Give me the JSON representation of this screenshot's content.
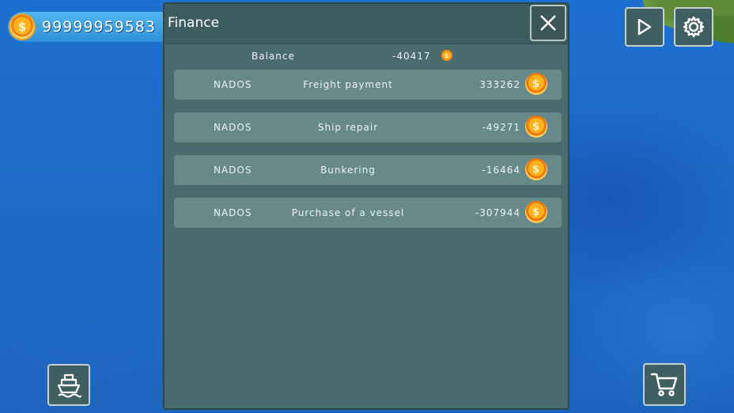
{
  "hud": {
    "coins": "99999959583",
    "coin_symbol": "$"
  },
  "dialog": {
    "title": "Finance",
    "balance_label": "Balance",
    "balance_value": "-40417",
    "rows": [
      {
        "company": "NADOS",
        "description": "Freight payment",
        "amount": "333262",
        "coin": "$"
      },
      {
        "company": "NADOS",
        "description": "Ship repair",
        "amount": "-49271",
        "coin": "$"
      },
      {
        "company": "NADOS",
        "description": "Bunkering",
        "amount": "-16464",
        "coin": "$"
      },
      {
        "company": "NADOS",
        "description": "Purchase of a vessel",
        "amount": "-307944",
        "coin": "$"
      }
    ]
  },
  "icons": {
    "close": "close-icon",
    "play": "play-icon",
    "settings": "gear-icon",
    "ship": "ship-icon",
    "cart": "cart-icon"
  },
  "colors": {
    "panel": "#4b6c6e",
    "row": "#67898a",
    "coin": "#ffb21c",
    "water": "#1f6bc8"
  }
}
